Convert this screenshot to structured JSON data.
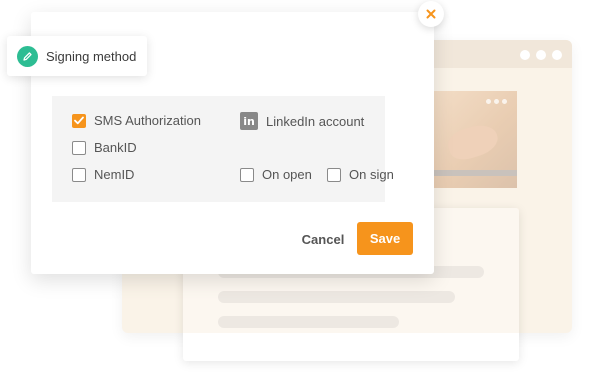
{
  "signing_method": {
    "title": "Signing method",
    "icon": "pencil-icon",
    "accent_color": "#2dbd93"
  },
  "options": {
    "sms": {
      "label": "SMS Authorization",
      "checked": true
    },
    "linkedin": {
      "label": "LinkedIn account",
      "icon": "linkedin-icon"
    },
    "bankid": {
      "label": "BankID",
      "checked": false
    },
    "nemid": {
      "label": "NemID",
      "checked": false
    },
    "on_open": {
      "label": "On open",
      "checked": false
    },
    "on_sign": {
      "label": "On sign",
      "checked": false
    }
  },
  "actions": {
    "cancel_label": "Cancel",
    "save_label": "Save"
  },
  "close_icon": "close-icon",
  "colors": {
    "accent": "#f6941c",
    "panel_bg": "#f4f4f4",
    "text": "#555555"
  }
}
